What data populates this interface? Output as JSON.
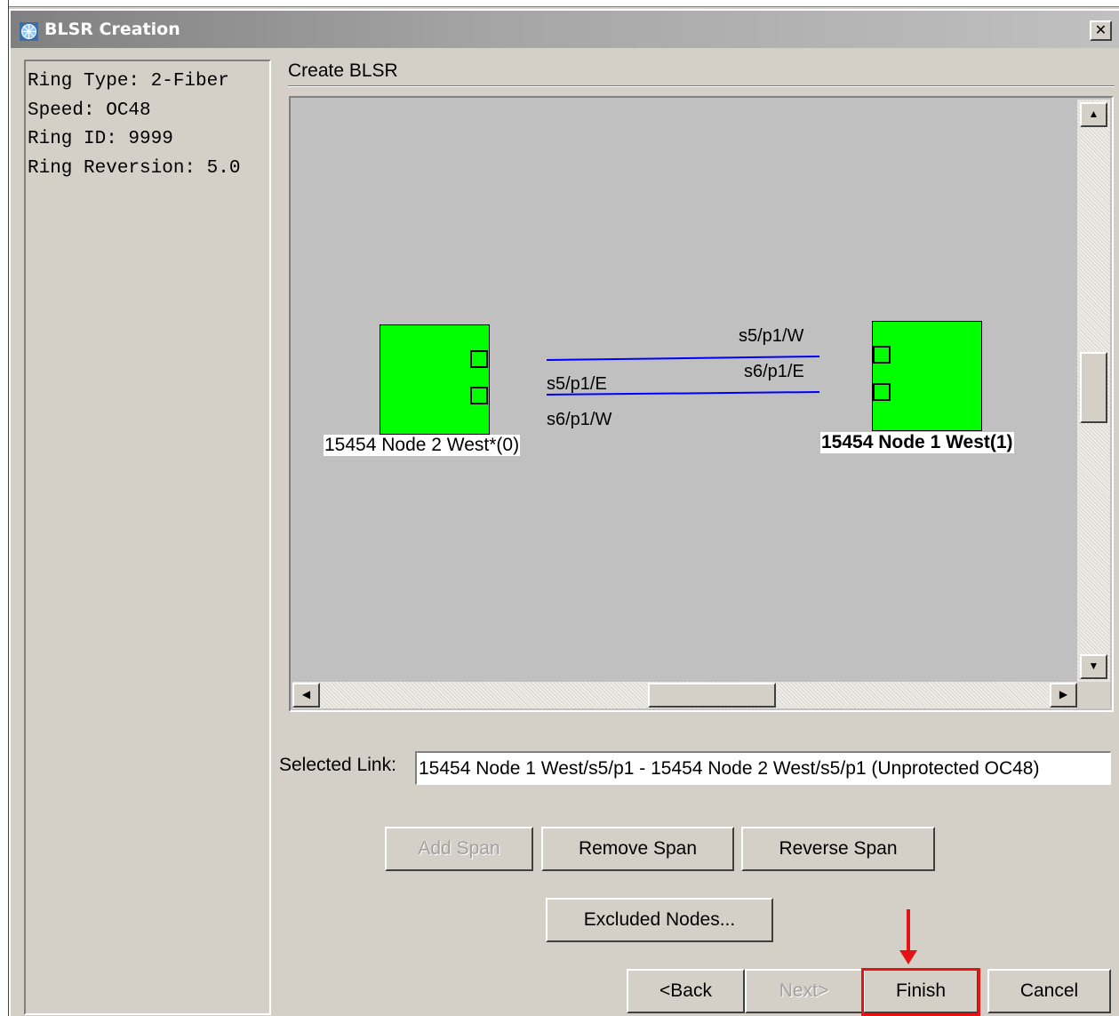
{
  "window": {
    "title": "BLSR Creation",
    "close_label": "✕"
  },
  "ring_info": [
    "Ring Type: 2-Fiber",
    "Speed: OC48",
    "Ring ID: 9999",
    "Ring Reversion: 5.0"
  ],
  "main": {
    "section_title": "Create BLSR"
  },
  "network": {
    "nodes": [
      {
        "label": "15454 Node 2 West*(0)",
        "selected": false
      },
      {
        "label": "15454 Node 1 West(1)",
        "selected": true
      }
    ],
    "port_labels": {
      "node1_west": "s5/p1/W",
      "node1_east": "s6/p1/E",
      "node2_east": "s5/p1/E",
      "node2_west": "s6/p1/W"
    },
    "node_color": "#00ff00",
    "link_color": "#0000ff"
  },
  "scroll": {
    "up": "▲",
    "down": "▼",
    "left": "◀",
    "right": "▶"
  },
  "selected_link": {
    "label": "Selected Link:",
    "value": "15454 Node 1 West/s5/p1 - 15454 Node 2 West/s5/p1 (Unprotected OC48)"
  },
  "buttons": {
    "add_span": "Add Span",
    "remove_span": "Remove Span",
    "reverse_span": "Reverse Span",
    "excluded_nodes": "Excluded Nodes...",
    "back": "<Back",
    "next": "Next>",
    "finish": "Finish",
    "cancel": "Cancel"
  },
  "annotation_color": "#e41414"
}
